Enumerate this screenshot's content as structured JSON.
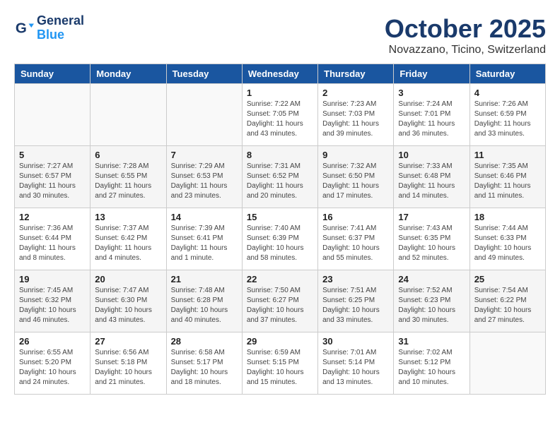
{
  "header": {
    "logo_line1": "General",
    "logo_line2": "Blue",
    "title": "October 2025",
    "subtitle": "Novazzano, Ticino, Switzerland"
  },
  "days_of_week": [
    "Sunday",
    "Monday",
    "Tuesday",
    "Wednesday",
    "Thursday",
    "Friday",
    "Saturday"
  ],
  "weeks": [
    [
      {
        "day": "",
        "info": ""
      },
      {
        "day": "",
        "info": ""
      },
      {
        "day": "",
        "info": ""
      },
      {
        "day": "1",
        "info": "Sunrise: 7:22 AM\nSunset: 7:05 PM\nDaylight: 11 hours\nand 43 minutes."
      },
      {
        "day": "2",
        "info": "Sunrise: 7:23 AM\nSunset: 7:03 PM\nDaylight: 11 hours\nand 39 minutes."
      },
      {
        "day": "3",
        "info": "Sunrise: 7:24 AM\nSunset: 7:01 PM\nDaylight: 11 hours\nand 36 minutes."
      },
      {
        "day": "4",
        "info": "Sunrise: 7:26 AM\nSunset: 6:59 PM\nDaylight: 11 hours\nand 33 minutes."
      }
    ],
    [
      {
        "day": "5",
        "info": "Sunrise: 7:27 AM\nSunset: 6:57 PM\nDaylight: 11 hours\nand 30 minutes."
      },
      {
        "day": "6",
        "info": "Sunrise: 7:28 AM\nSunset: 6:55 PM\nDaylight: 11 hours\nand 27 minutes."
      },
      {
        "day": "7",
        "info": "Sunrise: 7:29 AM\nSunset: 6:53 PM\nDaylight: 11 hours\nand 23 minutes."
      },
      {
        "day": "8",
        "info": "Sunrise: 7:31 AM\nSunset: 6:52 PM\nDaylight: 11 hours\nand 20 minutes."
      },
      {
        "day": "9",
        "info": "Sunrise: 7:32 AM\nSunset: 6:50 PM\nDaylight: 11 hours\nand 17 minutes."
      },
      {
        "day": "10",
        "info": "Sunrise: 7:33 AM\nSunset: 6:48 PM\nDaylight: 11 hours\nand 14 minutes."
      },
      {
        "day": "11",
        "info": "Sunrise: 7:35 AM\nSunset: 6:46 PM\nDaylight: 11 hours\nand 11 minutes."
      }
    ],
    [
      {
        "day": "12",
        "info": "Sunrise: 7:36 AM\nSunset: 6:44 PM\nDaylight: 11 hours\nand 8 minutes."
      },
      {
        "day": "13",
        "info": "Sunrise: 7:37 AM\nSunset: 6:42 PM\nDaylight: 11 hours\nand 4 minutes."
      },
      {
        "day": "14",
        "info": "Sunrise: 7:39 AM\nSunset: 6:41 PM\nDaylight: 11 hours\nand 1 minute."
      },
      {
        "day": "15",
        "info": "Sunrise: 7:40 AM\nSunset: 6:39 PM\nDaylight: 10 hours\nand 58 minutes."
      },
      {
        "day": "16",
        "info": "Sunrise: 7:41 AM\nSunset: 6:37 PM\nDaylight: 10 hours\nand 55 minutes."
      },
      {
        "day": "17",
        "info": "Sunrise: 7:43 AM\nSunset: 6:35 PM\nDaylight: 10 hours\nand 52 minutes."
      },
      {
        "day": "18",
        "info": "Sunrise: 7:44 AM\nSunset: 6:33 PM\nDaylight: 10 hours\nand 49 minutes."
      }
    ],
    [
      {
        "day": "19",
        "info": "Sunrise: 7:45 AM\nSunset: 6:32 PM\nDaylight: 10 hours\nand 46 minutes."
      },
      {
        "day": "20",
        "info": "Sunrise: 7:47 AM\nSunset: 6:30 PM\nDaylight: 10 hours\nand 43 minutes."
      },
      {
        "day": "21",
        "info": "Sunrise: 7:48 AM\nSunset: 6:28 PM\nDaylight: 10 hours\nand 40 minutes."
      },
      {
        "day": "22",
        "info": "Sunrise: 7:50 AM\nSunset: 6:27 PM\nDaylight: 10 hours\nand 37 minutes."
      },
      {
        "day": "23",
        "info": "Sunrise: 7:51 AM\nSunset: 6:25 PM\nDaylight: 10 hours\nand 33 minutes."
      },
      {
        "day": "24",
        "info": "Sunrise: 7:52 AM\nSunset: 6:23 PM\nDaylight: 10 hours\nand 30 minutes."
      },
      {
        "day": "25",
        "info": "Sunrise: 7:54 AM\nSunset: 6:22 PM\nDaylight: 10 hours\nand 27 minutes."
      }
    ],
    [
      {
        "day": "26",
        "info": "Sunrise: 6:55 AM\nSunset: 5:20 PM\nDaylight: 10 hours\nand 24 minutes."
      },
      {
        "day": "27",
        "info": "Sunrise: 6:56 AM\nSunset: 5:18 PM\nDaylight: 10 hours\nand 21 minutes."
      },
      {
        "day": "28",
        "info": "Sunrise: 6:58 AM\nSunset: 5:17 PM\nDaylight: 10 hours\nand 18 minutes."
      },
      {
        "day": "29",
        "info": "Sunrise: 6:59 AM\nSunset: 5:15 PM\nDaylight: 10 hours\nand 15 minutes."
      },
      {
        "day": "30",
        "info": "Sunrise: 7:01 AM\nSunset: 5:14 PM\nDaylight: 10 hours\nand 13 minutes."
      },
      {
        "day": "31",
        "info": "Sunrise: 7:02 AM\nSunset: 5:12 PM\nDaylight: 10 hours\nand 10 minutes."
      },
      {
        "day": "",
        "info": ""
      }
    ]
  ]
}
